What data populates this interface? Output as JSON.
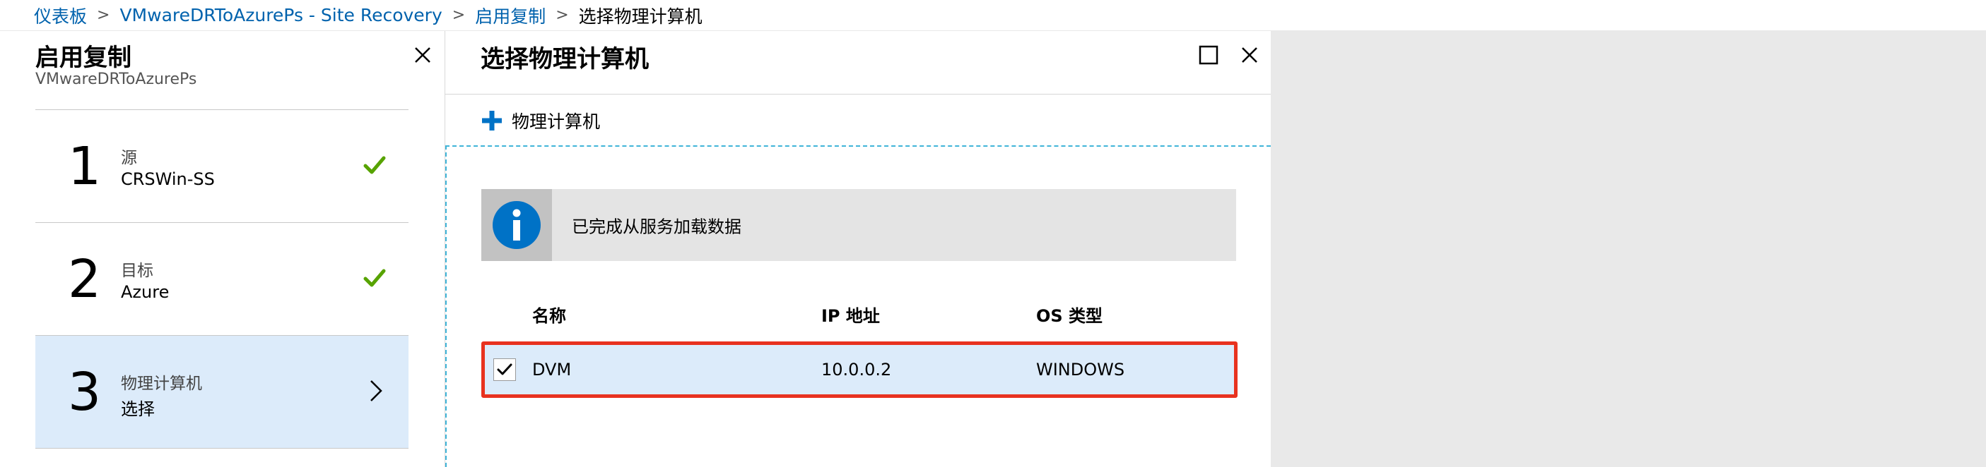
{
  "breadcrumb": {
    "items": [
      "仪表板",
      "VMwareDRToAzurePs - Site Recovery",
      "启用复制"
    ],
    "current": "选择物理计算机"
  },
  "enable_replication": {
    "title": "启用复制",
    "subtitle": "VMwareDRToAzurePs",
    "steps": [
      {
        "number": "1",
        "label": "源",
        "value": "CRSWin-SS",
        "status": "complete"
      },
      {
        "number": "2",
        "label": "目标",
        "value": "Azure",
        "status": "complete"
      },
      {
        "number": "3",
        "label": "物理计算机",
        "value": "选择",
        "status": "active"
      }
    ]
  },
  "select_machine": {
    "title": "选择物理计算机",
    "add_button_label": "物理计算机",
    "info_message": "已完成从服务加载数据",
    "columns": [
      "名称",
      "IP 地址",
      "OS 类型"
    ],
    "rows": [
      {
        "name": "DVM",
        "ip": "10.0.0.2",
        "os": "WINDOWS",
        "selected": true
      }
    ]
  },
  "colors": {
    "link": "#0062ad",
    "check_green": "#57a300",
    "active_step_bg": "#dcebfa",
    "highlight_border": "#e8321f",
    "info_blue": "#0072c6",
    "dashed_border": "#3fb4d8"
  },
  "icons": {
    "blade_close": "close-icon",
    "step_complete": "checkmark-icon",
    "step_next": "chevron-right-icon",
    "maximize": "maximize-icon",
    "add": "plus-icon",
    "info": "info-icon",
    "row_selected": "checkbox-checked-icon"
  }
}
